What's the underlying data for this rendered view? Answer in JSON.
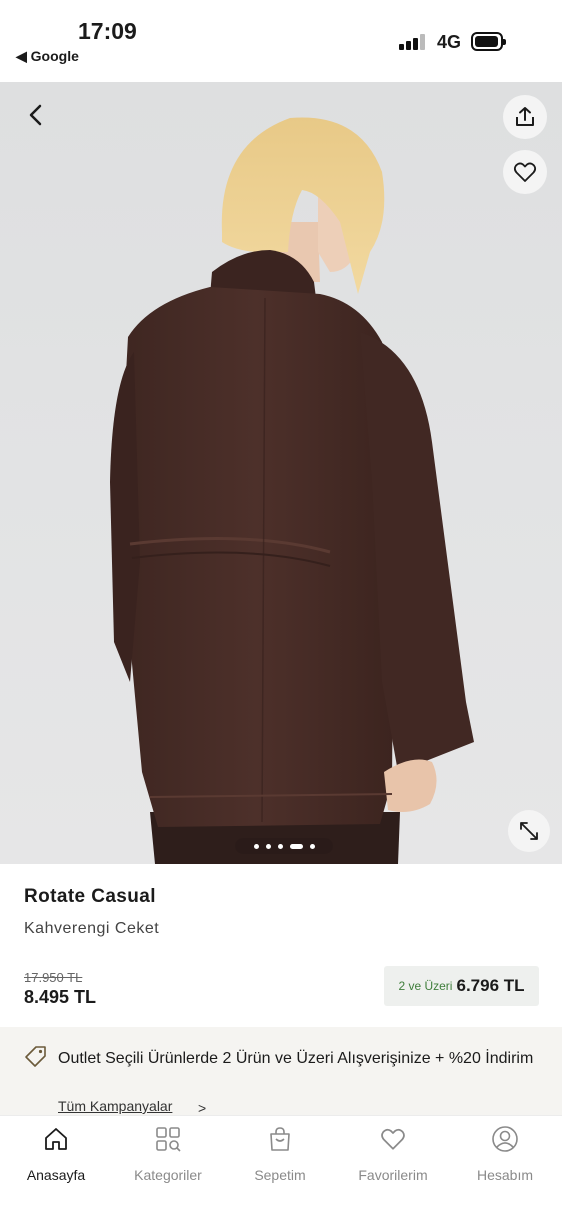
{
  "status_bar": {
    "time": "17:09",
    "back_app": "◀ Google",
    "network": "4G"
  },
  "gallery": {
    "image_subject": "woman-in-brown-jacket-back-view",
    "dot_count": 5,
    "active_dot": 3
  },
  "product": {
    "brand": "Rotate Casual",
    "name": "Kahverengi Ceket",
    "old_price": "17.950 TL",
    "price": "8.495 TL",
    "deal_label": "2 ve Üzeri",
    "deal_price": "6.796 TL"
  },
  "campaign": {
    "text": "Outlet Seçili Ürünlerde 2 Ürün ve Üzeri Alışverişinize + %20 İndirim",
    "link": "Tüm Kampanyalar",
    "link_arrow": ">"
  },
  "nav": {
    "home": "Anasayfa",
    "categories": "Kategoriler",
    "cart": "Sepetim",
    "favorites": "Favorilerim",
    "account": "Hesabım"
  },
  "colors": {
    "accent_green": "#3e7d3a",
    "jacket_brown": "#4a2e28",
    "campaign_bg": "#f5f4f1"
  }
}
